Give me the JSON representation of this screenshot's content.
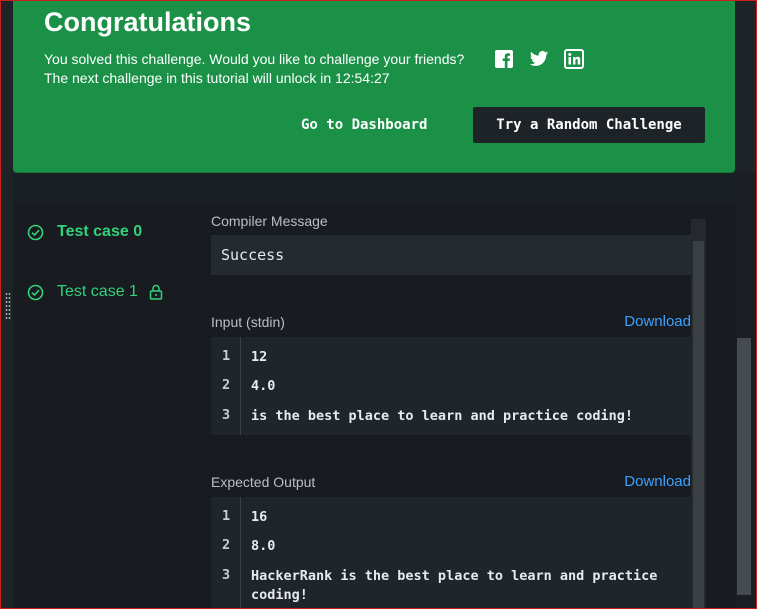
{
  "banner": {
    "title": "Congratulations",
    "line1": "You solved this challenge. Would you like to challenge your friends?",
    "line2": "The next challenge in this tutorial will unlock in 12:54:27",
    "social_icons": [
      "facebook-icon",
      "twitter-icon",
      "linkedin-icon"
    ],
    "dashboard_button": "Go to Dashboard",
    "random_button": "Try a Random Challenge",
    "color": "#1b9148"
  },
  "test_cases": [
    {
      "label": "Test case 0",
      "icon": "check-circle-icon",
      "locked": false
    },
    {
      "label": "Test case 1",
      "icon": "check-circle-icon",
      "locked": true
    }
  ],
  "result": {
    "compiler_label": "Compiler Message",
    "compiler_message": "Success",
    "input_label": "Input (stdin)",
    "input_download": "Download",
    "input_lines": [
      {
        "num": "1",
        "text": "12"
      },
      {
        "num": "2",
        "text": "4.0"
      },
      {
        "num": "3",
        "text": "is the best place to learn and practice coding!"
      }
    ],
    "output_label": "Expected Output",
    "output_download": "Download",
    "output_lines": [
      {
        "num": "1",
        "text": "16"
      },
      {
        "num": "2",
        "text": "8.0"
      },
      {
        "num": "3",
        "text": "HackerRank is the best place to learn and practice coding!"
      }
    ]
  },
  "colors": {
    "accent_green": "#33d17a",
    "link_blue": "#3ea1ff",
    "background": "#1e2328"
  }
}
